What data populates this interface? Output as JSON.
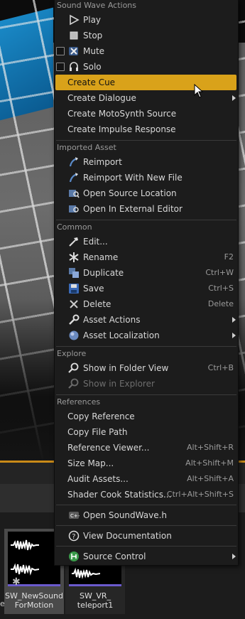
{
  "menu": {
    "sections": {
      "sound_wave_actions": "Sound Wave Actions",
      "imported_asset": "Imported Asset",
      "common": "Common",
      "explore": "Explore",
      "references": "References"
    },
    "play": "Play",
    "stop": "Stop",
    "mute": "Mute",
    "solo": "Solo",
    "create_cue": "Create Cue",
    "create_dialogue": "Create Dialogue",
    "create_motosynth": "Create MotoSynth Source",
    "create_impulse": "Create Impulse Response",
    "reimport": "Reimport",
    "reimport_new": "Reimport With New File",
    "open_source": "Open Source Location",
    "open_external": "Open In External Editor",
    "edit": "Edit...",
    "rename": {
      "label": "Rename",
      "shortcut": "F2"
    },
    "duplicate": {
      "label": "Duplicate",
      "shortcut": "Ctrl+W"
    },
    "save": {
      "label": "Save",
      "shortcut": "Ctrl+S"
    },
    "delete": {
      "label": "Delete",
      "shortcut": "Delete"
    },
    "asset_actions": "Asset Actions",
    "asset_localization": "Asset Localization",
    "show_folder": {
      "label": "Show in Folder View",
      "shortcut": "Ctrl+B"
    },
    "show_explorer": "Show in Explorer",
    "copy_reference": "Copy Reference",
    "copy_file_path": "Copy File Path",
    "reference_viewer": {
      "label": "Reference Viewer...",
      "shortcut": "Alt+Shift+R"
    },
    "size_map": {
      "label": "Size Map...",
      "shortcut": "Alt+Shift+M"
    },
    "audit_assets": {
      "label": "Audit Assets...",
      "shortcut": "Alt+Shift+A"
    },
    "shader_cook": {
      "label": "Shader Cook Statistics...",
      "shortcut": "Ctrl+Alt+Shift+S"
    },
    "open_header": "Open SoundWave.h",
    "view_docs": "View Documentation",
    "source_control": "Source Control"
  },
  "content_browser": {
    "partial_left": "e",
    "assets": [
      {
        "name_line1": "SW_NewSound",
        "name_line2": "ForMotion"
      },
      {
        "name_line1": "SW_VR_",
        "name_line2": "teleport1"
      }
    ]
  },
  "colors": {
    "highlight": "#d9a21a",
    "menu_bg": "#1c1c1c",
    "accent_orange": "#c98a18"
  }
}
